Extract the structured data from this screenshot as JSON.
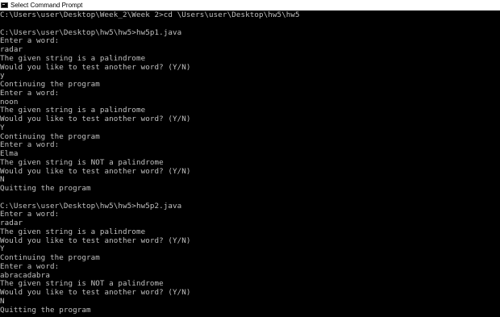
{
  "window": {
    "title": "Select Command Prompt",
    "icon": "cmd-icon"
  },
  "console": {
    "lines": [
      "C:\\Users\\user\\Desktop\\Week_2\\Week 2>cd \\Users\\user\\Desktop\\hw5\\hw5",
      "",
      "C:\\Users\\user\\Desktop\\hw5\\hw5>hw5p1.java",
      "Enter a word:",
      "radar",
      "The given string is a palindrome",
      "Would you like to test another word? (Y/N)",
      "y",
      "Continuing the program",
      "Enter a word:",
      "noon",
      "The given string is a palindrome",
      "Would you like to test another word? (Y/N)",
      "Y",
      "Continuing the program",
      "Enter a word:",
      "Elma",
      "The given string is NOT a palindrome",
      "Would you like to test another word? (Y/N)",
      "N",
      "Quitting the program",
      "",
      "C:\\Users\\user\\Desktop\\hw5\\hw5>hw5p2.java",
      "Enter a word:",
      "radar",
      "The given string is a palindrome",
      "Would you like to test another word? (Y/N)",
      "Y",
      "Continuing the program",
      "Enter a word:",
      "abracadabra",
      "The given string is NOT a palindrome",
      "Would you like to test another word? (Y/N)",
      "N",
      "Quitting the program"
    ]
  },
  "colors": {
    "background": "#000000",
    "text": "#c0c0c0",
    "titlebar": "#ffffff"
  }
}
